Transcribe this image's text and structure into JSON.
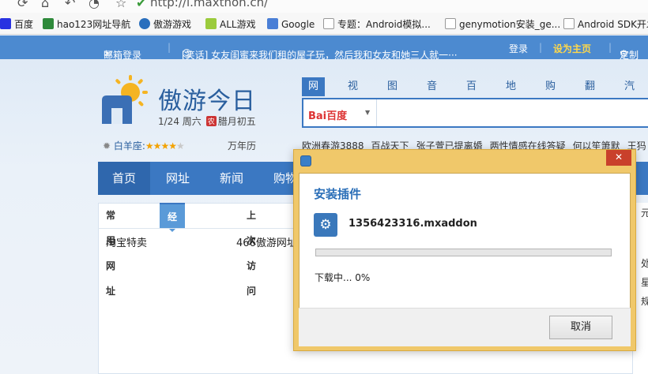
{
  "toolbar": {
    "url": "http://i.maxthon.cn/"
  },
  "bookmarks": [
    {
      "label": "百度",
      "icon": "baidu-paw-icon",
      "color": "#2932e1"
    },
    {
      "label": "hao123网址导航",
      "icon": "hao123-icon",
      "color": "#2f8a3b"
    },
    {
      "label": "傲游游戏",
      "icon": "maxthon-games-icon",
      "color": "#2a6fbd"
    },
    {
      "label": "ALL游戏",
      "icon": "android-icon",
      "color": "#9bcb3c"
    },
    {
      "label": "Google",
      "icon": "google-icon",
      "color": "#4a7fd6"
    },
    {
      "label": "专题：Android模拟...",
      "icon": "page-icon",
      "color": "#ffffff"
    },
    {
      "label": "genymotion安装_ge...",
      "icon": "page-icon",
      "color": "#ffffff"
    },
    {
      "label": "Android SDK开发",
      "icon": "page-icon",
      "color": "#ffffff"
    }
  ],
  "infobar": {
    "mail_login": "邮箱登录",
    "news": "[笑话] 女友闺蜜来我们租的屋子玩，然后我和女友和她三人就一···",
    "login": "登录",
    "set_home": "设为主页",
    "customize": "定制"
  },
  "site": {
    "title": "傲游今日",
    "date": "1/24 周六",
    "lunar_badge": "农",
    "lunar": "腊月初五",
    "horoscope_label": "白羊座:",
    "horoscope_rating": 4,
    "calendar": "万年历"
  },
  "search": {
    "tabs": [
      "网页",
      "视频",
      "图片",
      "音乐",
      "百科",
      "地图",
      "购物",
      "翻译",
      "汽车"
    ],
    "engine_logo": "Bai百度",
    "hot": [
      "欧洲春游3888",
      "百战天下",
      "张子萱已提离婚",
      "两性情感在线答疑",
      "何以笙箫默",
      "王犸"
    ]
  },
  "mainnav": [
    "首页",
    "网址",
    "新闻",
    "购物"
  ],
  "content": {
    "tabs": [
      "常用网址",
      "经常访问网站",
      "上次访问"
    ],
    "links": [
      "淘宝特卖",
      "466傲游网址"
    ],
    "right_col": [
      "元",
      "处",
      "星",
      "规"
    ]
  },
  "dialog": {
    "title": "安装插件",
    "filename": "1356423316.mxaddon",
    "progress": 0,
    "status": "下载中... 0%",
    "cancel": "取消",
    "close": "✕"
  }
}
